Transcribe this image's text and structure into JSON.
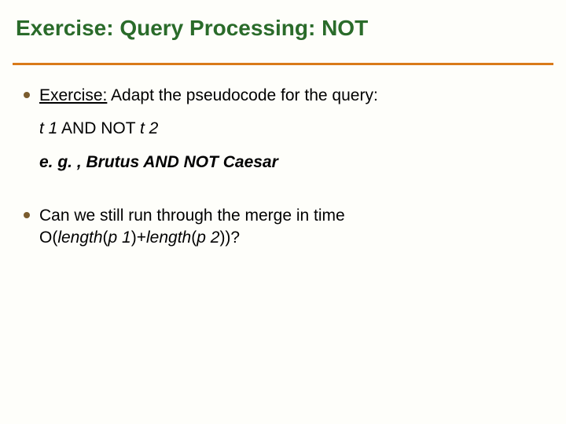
{
  "title": "Exercise: Query Processing: NOT",
  "b1": {
    "lead": "Exercise:",
    "rest": " Adapt the pseudocode for the query:"
  },
  "line2": {
    "t1": "t 1",
    "mid": " AND NOT ",
    "t2": "t 2"
  },
  "line3": {
    "eg": "e. g. , ",
    "rest": "Brutus AND NOT Caesar"
  },
  "b2": {
    "l1": "Can we still run through the merge in time",
    "l2a": "O(",
    "l2b": "length",
    "l2c": "(",
    "l2d": "p 1",
    "l2e": ")+",
    "l2f": "length",
    "l2g": "(",
    "l2h": "p 2",
    "l2i": "))?"
  }
}
